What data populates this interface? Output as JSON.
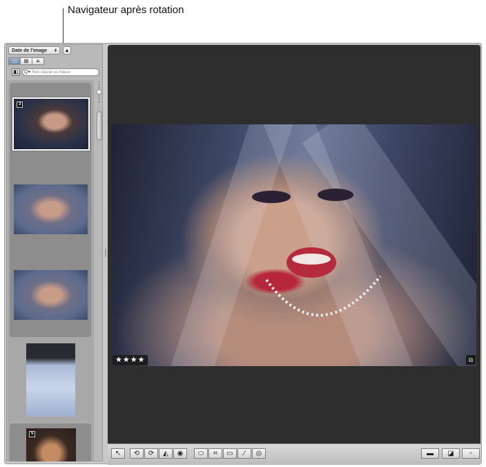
{
  "callout": {
    "text": "Navigateur après rotation"
  },
  "browser": {
    "sort": {
      "label": "Date de l'image",
      "arrow": "⇕",
      "direction_icon": "▲"
    },
    "view_buttons": [
      {
        "name": "filmstrip-view-icon",
        "glyph": "▭"
      },
      {
        "name": "grid-view-icon",
        "glyph": "⊞"
      },
      {
        "name": "list-view-icon",
        "glyph": "≡"
      }
    ],
    "filter_icon": "◧",
    "search": {
      "icon": "Q▾",
      "placeholder": "Non classé ou mieux"
    },
    "thumbnails": [
      {
        "badge": "3"
      },
      {
        "badge": ""
      },
      {
        "badge": ""
      },
      {
        "badge": ""
      },
      {
        "badge": "5"
      }
    ]
  },
  "viewer": {
    "rating": "★★★★",
    "adjust_badge": "⧉"
  },
  "toolbar": {
    "tools": [
      "↖",
      "⟲",
      "⟳",
      "◭",
      "◉",
      "⬭",
      "⌗",
      "▭",
      "⁄",
      "◎"
    ],
    "right": [
      "▬",
      "◪",
      "▫"
    ]
  }
}
